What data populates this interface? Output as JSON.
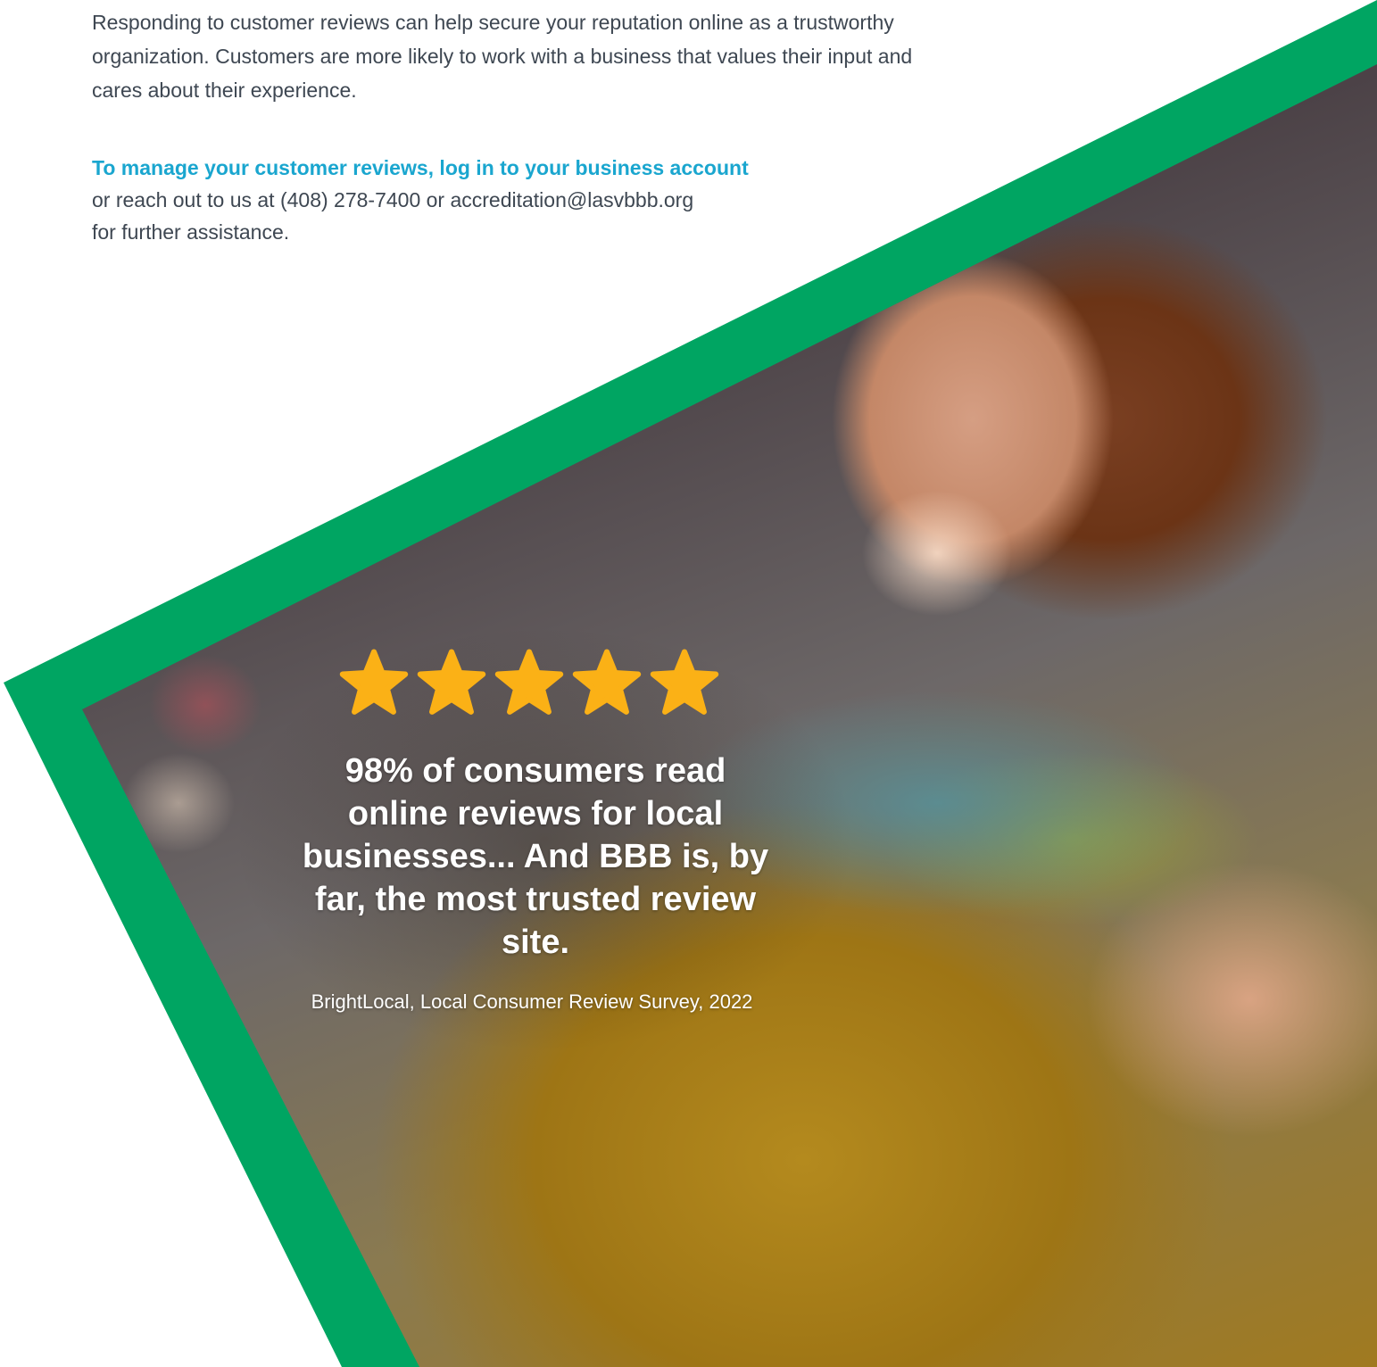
{
  "intro": {
    "paragraph": "Responding to customer reviews can help secure your reputation online as a trustworthy organization. Customers are more likely to work with a business that values their input and cares about their experience."
  },
  "cta": {
    "link_text": "To manage your customer reviews, log in to your business account",
    "line2": "or reach out to us at (408) 278-7400 or accreditation@lasvbbb.org",
    "line3": "for further assistance."
  },
  "rating": {
    "stars": 5,
    "max_stars": 5,
    "icon": "star-icon",
    "color": "#fbb116"
  },
  "callout": {
    "stat": "98% of consumers read online reviews for local businesses... And BBB is, by far, the most trusted review site.",
    "source": "BrightLocal, Local Consumer Review Survey, 2022"
  },
  "colors": {
    "brand_green": "#00a562",
    "link_blue": "#1aa6cf",
    "body_text": "#3e4752"
  }
}
